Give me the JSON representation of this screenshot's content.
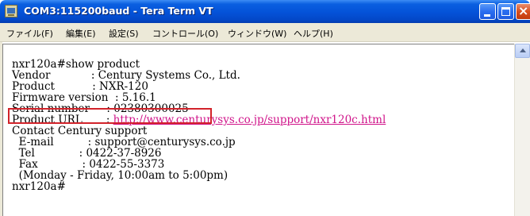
{
  "window": {
    "title": "COM3:115200baud - Tera Term VT"
  },
  "menu": {
    "items": [
      "ファイル(F)",
      "編集(E)",
      "設定(S)",
      "コントロール(O)",
      "ウィンドウ(W)",
      "ヘルプ(H)"
    ]
  },
  "terminal": {
    "lines": [
      "nxr120a#show product",
      "Vendor            : Century Systems Co., Ltd.",
      "Product           : NXR-120",
      "Firmware version  : 5.16.1",
      "Serial number     : 02380300025",
      "Product URL       : ",
      "Contact Century support",
      "  E-mail          : support@centurysys.co.jp",
      "  Tel             : 0422-37-8926",
      "  Fax             : 0422-55-3373",
      "  (Monday - Friday, 10:00am to 5:00pm)",
      "nxr120a#"
    ],
    "product_url": "http://www.centurysys.co.jp/support/nxr120c.html",
    "highlight_color": "#d2232a",
    "link_color": "#d0148a"
  },
  "icons": {
    "app": "tera-term-icon",
    "minimize": "minimize-icon",
    "maximize": "maximize-icon",
    "close": "close-icon",
    "scroll_up": "scroll-up-arrow-icon"
  }
}
